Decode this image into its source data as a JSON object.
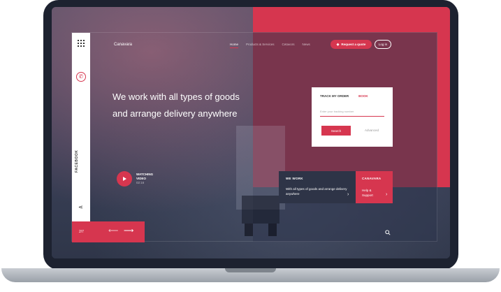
{
  "app": {
    "brand": "Canavara"
  },
  "nav": {
    "items": [
      "Home",
      "Products & Services",
      "Cetavors",
      "News"
    ],
    "active": "Home"
  },
  "header": {
    "quote_label": "Request a quote",
    "login_label": "Log in"
  },
  "hero": {
    "title": "We work with all types of goods and arrange delivery anywhere"
  },
  "video": {
    "label_line1": "WATCHING",
    "label_line2": "VIDEO",
    "duration": "02:16"
  },
  "sidebar": {
    "social": "FACEBOOK"
  },
  "pager": {
    "count": "2/7"
  },
  "track": {
    "tab_track": "TRACK MY ORDER",
    "tab_book": "BOOK",
    "placeholder": "Enter your tracking number",
    "search_label": "Search",
    "advanced_label": "Advanced"
  },
  "we_work": {
    "title": "WE WORK",
    "desc": "With all types of goods and arrange delivery anywhere"
  },
  "canavara_card": {
    "title": "CANAVARA",
    "desc_line1": "Help &",
    "desc_line2": "Support"
  },
  "colors": {
    "accent": "#d6364f",
    "navy": "#2e3447",
    "white": "#ffffff"
  },
  "icons": [
    "grid-icon",
    "phone-icon",
    "share-icon",
    "play-icon",
    "arrow-left-icon",
    "arrow-right-icon",
    "search-icon",
    "tag-icon"
  ]
}
